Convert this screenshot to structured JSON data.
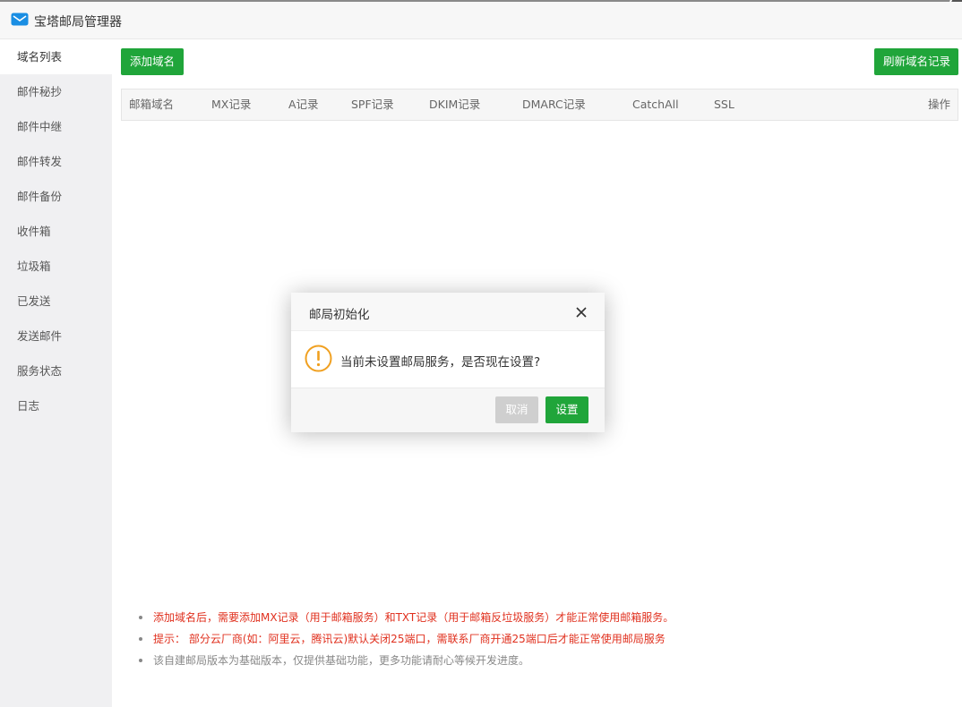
{
  "window": {
    "title": "宝塔邮局管理器",
    "app_icon": "mail-envelope-icon"
  },
  "sidebar": {
    "items": [
      {
        "label": "域名列表",
        "active": true
      },
      {
        "label": "邮件秘抄"
      },
      {
        "label": "邮件中继"
      },
      {
        "label": "邮件转发"
      },
      {
        "label": "邮件备份"
      },
      {
        "label": "收件箱"
      },
      {
        "label": "垃圾箱"
      },
      {
        "label": "已发送"
      },
      {
        "label": "发送邮件"
      },
      {
        "label": "服务状态"
      },
      {
        "label": "日志"
      }
    ]
  },
  "toolbar": {
    "add_domain": "添加域名",
    "refresh_records": "刷新域名记录"
  },
  "table": {
    "columns": [
      "邮箱域名",
      "MX记录",
      "A记录",
      "SPF记录",
      "DKIM记录",
      "DMARC记录",
      "CatchAll",
      "SSL",
      "操作"
    ],
    "rows": []
  },
  "notes": [
    "添加域名后，需要添加MX记录（用于邮箱服务）和TXT记录（用于邮箱反垃圾服务）才能正常使用邮箱服务。",
    "提示： 部分云厂商(如：阿里云，腾讯云)默认关闭25端口，需联系厂商开通25端口后才能正常使用邮局服务",
    "该自建邮局版本为基础版本，仅提供基础功能，更多功能请耐心等候开发进度。"
  ],
  "dialog": {
    "title": "邮局初始化",
    "message": "当前未设置邮局服务，是否现在设置?",
    "cancel": "取消",
    "confirm": "设置",
    "icon": "warning-icon"
  },
  "colors": {
    "primary_green": "#20a53a",
    "warning_orange": "#f0a020",
    "note_red": "#e0301e",
    "sidebar_bg": "#f0f0f2"
  }
}
